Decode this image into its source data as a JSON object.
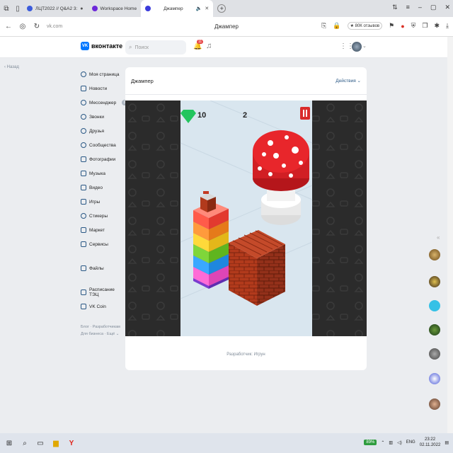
{
  "browser": {
    "tabs": [
      {
        "label": "ЛЦТ2022 // Q&A2 3:"
      },
      {
        "label": "Workspace Home"
      },
      {
        "label": "Джампер",
        "active": true
      }
    ],
    "url": "vk.com",
    "page_title": "Джампер",
    "reviews": "★ 80К отзывов"
  },
  "vk": {
    "logo": "вконтакте",
    "search_placeholder": "Поиск",
    "notif_count": "11",
    "back": "Назад"
  },
  "sidebar": {
    "items": [
      {
        "label": "Моя страница"
      },
      {
        "label": "Новости"
      },
      {
        "label": "Мессенджер",
        "count": "3"
      },
      {
        "label": "Звонки"
      },
      {
        "label": "Друзья"
      },
      {
        "label": "Сообщества"
      },
      {
        "label": "Фотографии"
      },
      {
        "label": "Музыка"
      },
      {
        "label": "Видео"
      },
      {
        "label": "Игры"
      },
      {
        "label": "Стикеры"
      },
      {
        "label": "Маркет"
      },
      {
        "label": "Сервисы"
      },
      {
        "label": "Файлы"
      },
      {
        "label": "Расписание ТЭЦ"
      },
      {
        "label": "VK Coin"
      }
    ],
    "footer_line1": "Блог · Разработчикам",
    "footer_line2": "Для бизнеса · Ещё ⌄"
  },
  "content": {
    "title": "Джампер",
    "actions": "Действия ⌄",
    "developer": "Разработчик: Игрун"
  },
  "game": {
    "gems": "10",
    "score": "2",
    "gem_color": "#22c55e",
    "pause_color": "#d92b2b"
  },
  "taskbar": {
    "battery": "89%",
    "lang": "ENG",
    "time": "23:22",
    "date": "02.11.2022"
  }
}
